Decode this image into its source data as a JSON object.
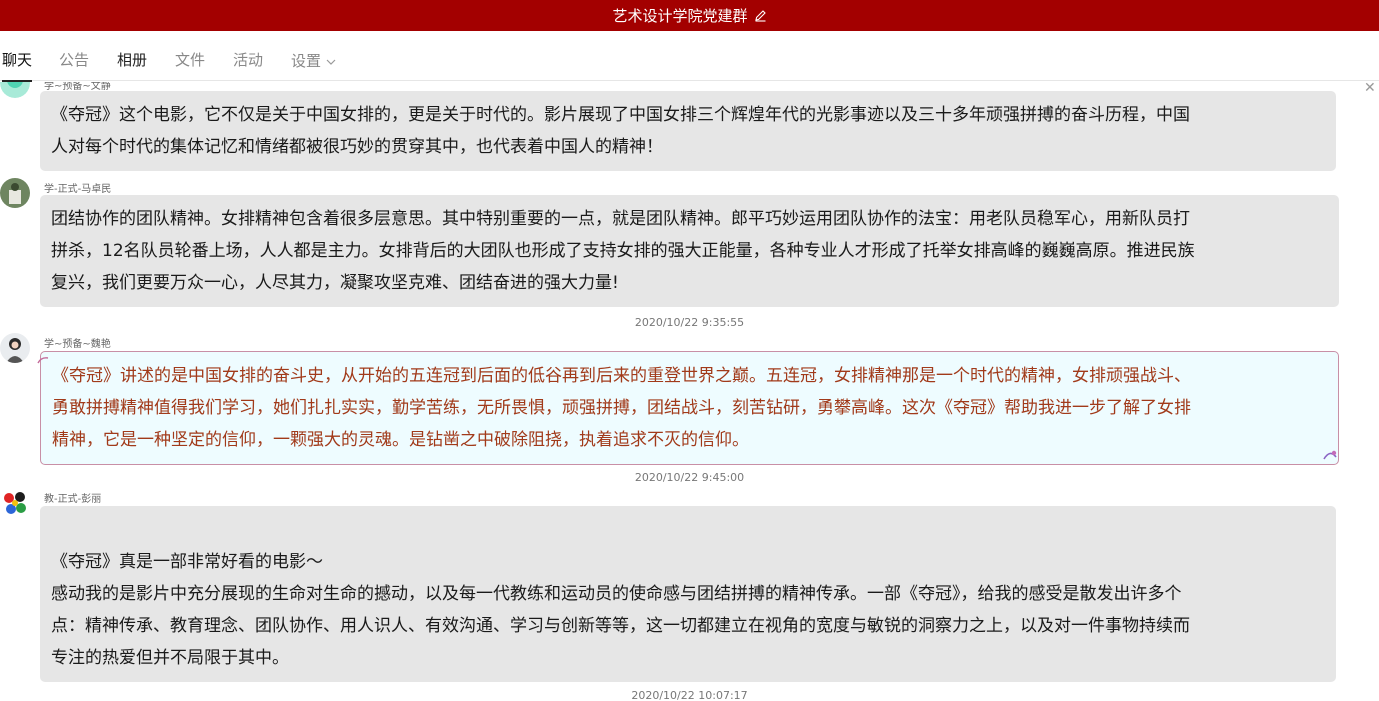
{
  "window": {
    "title": "艺术设计学院党建群"
  },
  "tabs": [
    {
      "label": "聊天"
    },
    {
      "label": "公告"
    },
    {
      "label": "相册"
    },
    {
      "label": "文件"
    },
    {
      "label": "活动"
    },
    {
      "label": "设置"
    }
  ],
  "messages": [
    {
      "sender": "学~预备~文静",
      "lines": [
        "《夺冠》这个电影，它不仅是关于中国女排的，更是关于时代的。影片展现了中国女排三个辉煌年代的光影事迹以及三十多年顽强拼搏的奋斗历程，中国",
        "人对每个时代的集体记忆和情绪都被很巧妙的贯穿其中，也代表着中国人的精神！"
      ]
    },
    {
      "sender": "学-正式-马卓民",
      "lines": [
        "团结协作的团队精神。女排精神包含着很多层意思。其中特别重要的一点，就是团队精神。郎平巧妙运用团队协作的法宝：用老队员稳军心，用新队员打",
        "拼杀，12名队员轮番上场，人人都是主力。女排背后的大团队也形成了支持女排的强大正能量，各种专业人才形成了托举女排高峰的巍巍高原。推进民族",
        "复兴，我们更要万众一心，人尽其力，凝聚攻坚克难、团结奋进的强大力量!"
      ]
    },
    {
      "timestamp": "2020/10/22 9:35:55",
      "sender": "学~预备~魏艳",
      "lines": [
        "《夺冠》讲述的是中国女排的奋斗史，从开始的五连冠到后面的低谷再到后来的重登世界之巅。五连冠，女排精神那是一个时代的精神，女排顽强战斗、",
        "勇敢拼搏精神值得我们学习，她们扎扎实实，勤学苦练，无所畏惧，顽强拼搏，团结战斗，刻苦钻研，勇攀高峰。这次《夺冠》帮助我进一步了解了女排",
        "精神，它是一种坚定的信仰，一颗强大的灵魂。是钻凿之中破除阻挠，执着追求不灭的信仰。"
      ]
    },
    {
      "timestamp": "2020/10/22 9:45:00",
      "sender": "教-正式-彭丽",
      "lines": [
        "",
        "《夺冠》真是一部非常好看的电影～",
        "感动我的是影片中充分展现的生命对生命的撼动，以及每一代教练和运动员的使命感与团结拼搏的精神传承。一部《夺冠》，给我的感受是散发出许多个",
        "点：精神传承、教育理念、团队协作、用人识人、有效沟通、学习与创新等等，这一切都建立在视角的宽度与敏锐的洞察力之上，以及对一件事物持续而",
        "专注的热爱但并不局限于其中。"
      ]
    }
  ],
  "trailing_timestamp": "2020/10/22 10:07:17",
  "colors": {
    "titlebar": "#a30000",
    "fancy_text": "#a13a1a",
    "fancy_bg": "#eefcff"
  },
  "icons": {
    "title_edit": "pencil-icon",
    "settings_chevron": "chevron-down-icon",
    "close": "close-icon"
  }
}
